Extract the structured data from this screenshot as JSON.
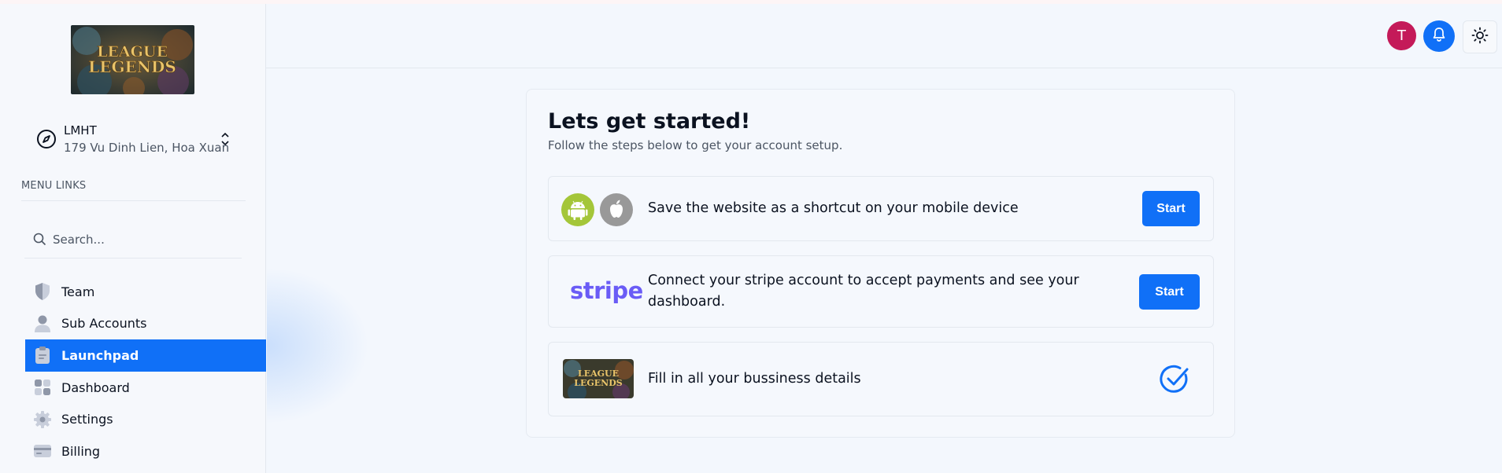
{
  "brand": {
    "logo_text_1": "LEAGUE",
    "logo_text_2": "LEGENDS"
  },
  "account": {
    "name": "LMHT",
    "address": "179 Vu Dinh Lien, Hoa Xuan"
  },
  "sidebar": {
    "menu_label": "MENU LINKS",
    "search_placeholder": "Search...",
    "items": [
      {
        "label": "Team",
        "icon": "shield-icon"
      },
      {
        "label": "Sub Accounts",
        "icon": "person-icon"
      },
      {
        "label": "Launchpad",
        "icon": "clipboard-icon",
        "active": true
      },
      {
        "label": "Dashboard",
        "icon": "dashboard-icon"
      },
      {
        "label": "Settings",
        "icon": "gear-icon"
      },
      {
        "label": "Billing",
        "icon": "credit-card-icon"
      }
    ]
  },
  "header": {
    "avatar_initial": "T"
  },
  "launchpad": {
    "title": "Lets get started!",
    "subtitle": "Follow the steps below to get your account setup.",
    "steps": [
      {
        "text": "Save the website as a shortcut on your mobile device",
        "button": "Start",
        "done": false
      },
      {
        "text": "Connect your stripe account to accept payments and see your dashboard.",
        "logo": "stripe",
        "button": "Start",
        "done": false
      },
      {
        "text": "Fill in all your bussiness details",
        "done": true
      }
    ]
  },
  "colors": {
    "accent": "#1070f7",
    "avatar": "#c41a59",
    "android": "#a4c639",
    "apple": "#999999",
    "stripe": "#6a5cf6"
  }
}
